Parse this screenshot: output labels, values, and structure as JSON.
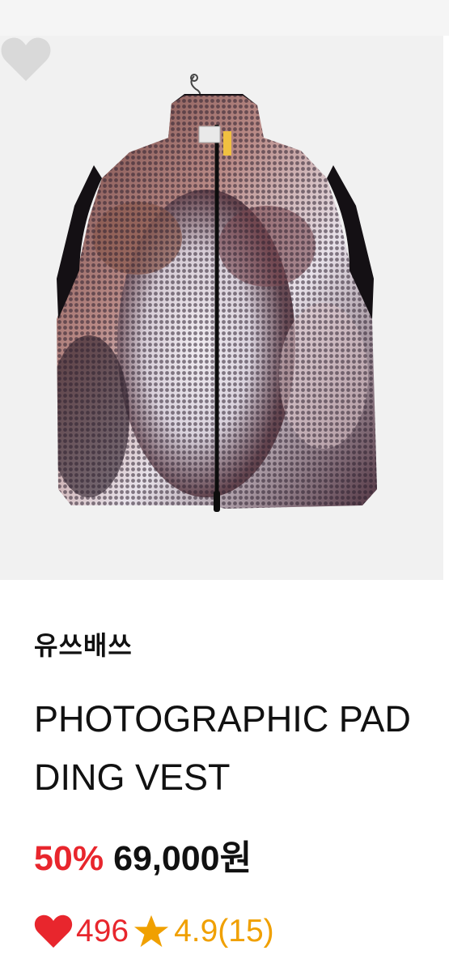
{
  "product": {
    "brand": "유쓰배쓰",
    "title": "PHOTOGRAPHIC PADDING VEST",
    "discount": "50%",
    "price": "69,000",
    "currency": "원",
    "likes": "496",
    "rating": "4.9",
    "review_count": "(15)"
  },
  "icons": {
    "wishlist": "heart-outline-icon",
    "likes": "heart-icon",
    "rating": "star-icon"
  },
  "colors": {
    "accent_red": "#e8262d",
    "rating_gold": "#f0a000",
    "wishlist_heart": "#d9d9d9"
  }
}
